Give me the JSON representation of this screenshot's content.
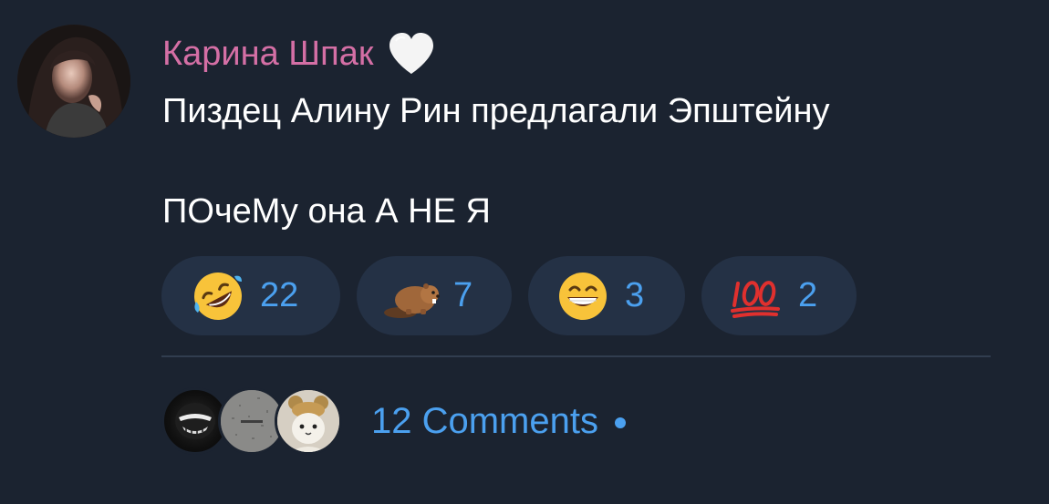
{
  "post": {
    "author": "Карина Шпак",
    "author_badge": "white-heart-icon",
    "message_line1": "Пиздец Алину Рин предлагали Эпштейну",
    "message_line2": "ПОчеМу она А НЕ Я"
  },
  "reactions": [
    {
      "emoji": "rolling-on-floor-laughing-icon",
      "count": "22"
    },
    {
      "emoji": "beaver-icon",
      "count": "7"
    },
    {
      "emoji": "grinning-face-icon",
      "count": "3"
    },
    {
      "emoji": "hundred-points-icon",
      "count": "2"
    }
  ],
  "comments": {
    "label": "12 Comments",
    "unread_indicator": true
  },
  "colors": {
    "background": "#1b2330",
    "author": "#d46fa5",
    "accent": "#4ba0ef",
    "reaction_bg": "#243145"
  }
}
